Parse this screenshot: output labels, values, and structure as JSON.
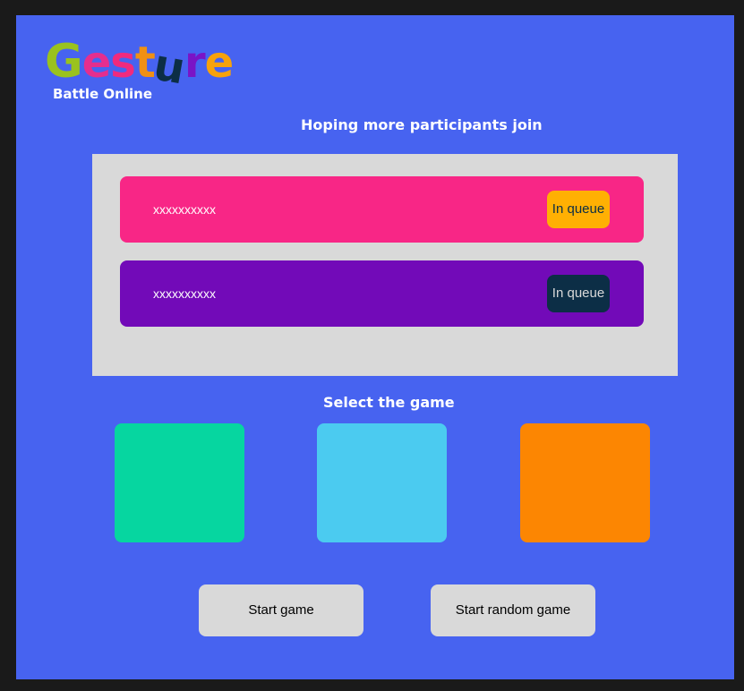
{
  "app": {
    "logo_letters": [
      "G",
      "e",
      "s",
      "t",
      "u",
      "r",
      "e"
    ],
    "subtitle": "Battle Online"
  },
  "queue": {
    "heading": "Hoping more participants join",
    "players": [
      {
        "name": "xxxxxxxxxx",
        "status": "In queue",
        "card_color": "#f82686",
        "badge_color": "#ffb003"
      },
      {
        "name": "xxxxxxxxxx",
        "status": "In queue",
        "card_color": "#720ab8",
        "badge_color": "#0c2e46"
      }
    ]
  },
  "games": {
    "heading": "Select the game",
    "tiles": [
      {
        "color": "#06d6a0"
      },
      {
        "color": "#4bcbf0"
      },
      {
        "color": "#fc8602"
      }
    ]
  },
  "actions": {
    "start_label": "Start game",
    "random_label": "Start random game"
  },
  "theme": {
    "background": "#4763f0",
    "panel": "#d9d9d9"
  }
}
